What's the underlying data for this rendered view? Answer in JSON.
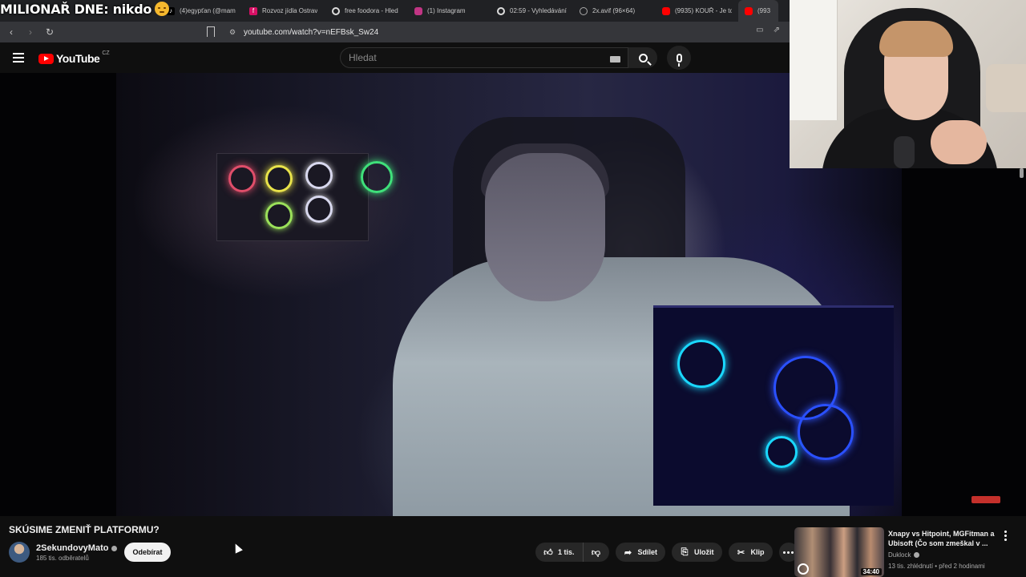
{
  "overlay": {
    "title": "MILIONAŘ DNE: nikdo"
  },
  "tabs": [
    {
      "label": "(4)egypťan (@mam",
      "icon": "tiktok-icon",
      "color": "#000000"
    },
    {
      "label": "Rozvoz jídla Ostrav",
      "icon": "foodora-icon",
      "color": "#d70f64"
    },
    {
      "label": "free foodora - Hled",
      "icon": "google-icon",
      "color": "#4285f4"
    },
    {
      "label": "(1) Instagram",
      "icon": "instagram-icon",
      "color": "#c13584"
    },
    {
      "label": "02:59 - Vyhledávání",
      "icon": "google-icon",
      "color": "#4285f4"
    },
    {
      "label": "2x.avif (96×64)",
      "icon": "globe-icon",
      "color": "#888888"
    },
    {
      "label": "(9935) KOUŘ - Je to",
      "icon": "youtube-icon",
      "color": "#ff0000"
    },
    {
      "label": "(993",
      "icon": "youtube-icon",
      "color": "#ff0000"
    }
  ],
  "browser": {
    "url": "youtube.com/watch?v=nEFBsk_Sw24"
  },
  "youtube": {
    "logo_text": "YouTube",
    "country": "CZ",
    "search_placeholder": "Hledat"
  },
  "video": {
    "title": "SKÚSIME ZMENIŤ PLATFORMU?",
    "channel": "2SekundovyMato",
    "subscribers": "185 tis. odběratelů",
    "subscribe_label": "Odebírat",
    "likes": "1 tis.",
    "share_label": "Sdílet",
    "save_label": "Uložit",
    "clip_label": "Klip"
  },
  "recommended": {
    "title": "Xnapy vs Hitpoint, MGFitman a Ubisoft (Čo som zmeškal v ...",
    "channel": "Duklock",
    "meta": "13 tis. zhlédnutí • před 2 hodinami",
    "duration": "34:40"
  },
  "colors": {
    "accent": "#ff0000",
    "background": "#0f0f0f",
    "pill": "#272727"
  }
}
